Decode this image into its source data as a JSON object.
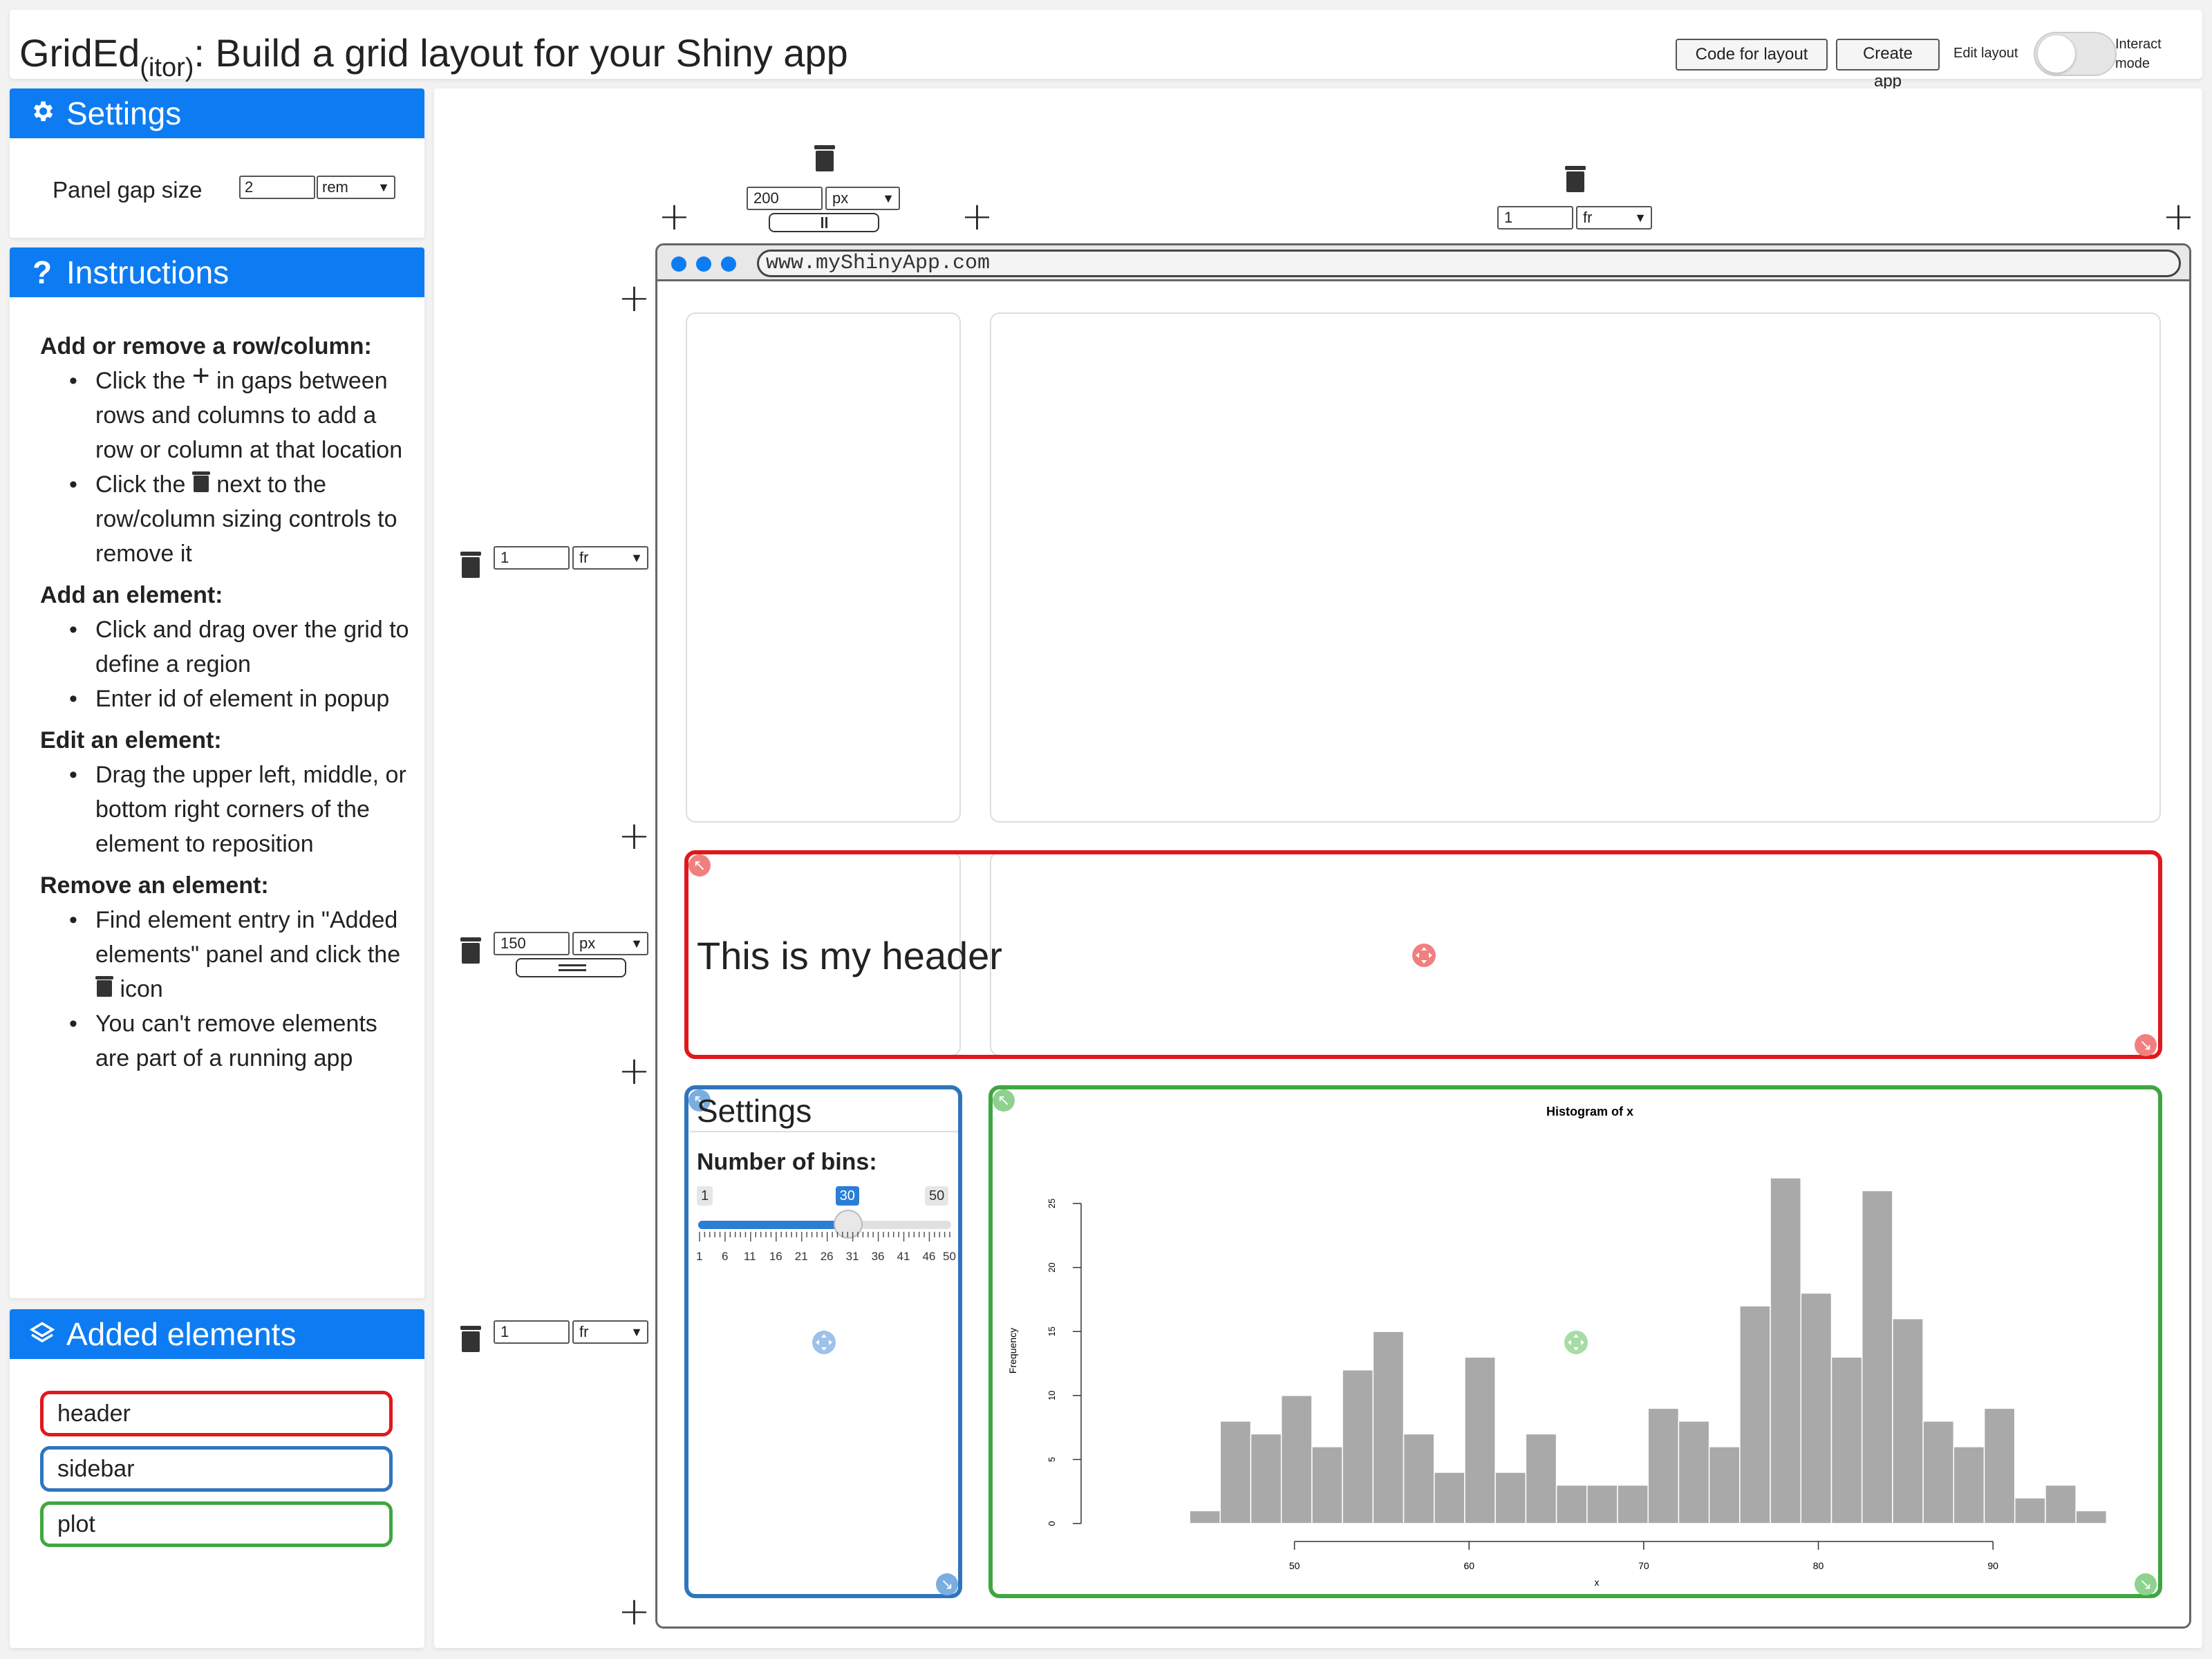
{
  "header": {
    "title_main": "GridEd",
    "title_sub": "(itor)",
    "title_rest": ": Build a grid layout for your Shiny app",
    "btn_code": "Code for layout",
    "btn_create": "Create app",
    "edit_label": "Edit layout",
    "interact_label": "Interact mode",
    "interact_on": false
  },
  "settings": {
    "title": "Settings",
    "gap_label": "Panel gap size",
    "gap_value": "2",
    "gap_unit": "rem"
  },
  "instructions": {
    "title": "Instructions",
    "s1_title": "Add or remove a row/column:",
    "s1_b1_pre": "Click the",
    "s1_b1_post": "in gaps between rows and columns to add a row or column at that location",
    "s1_b2_pre": "Click the",
    "s1_b2_post": "next to the row/column sizing controls to remove it",
    "s2_title": "Add an element:",
    "s2_b1": "Click and drag over the grid to define a region",
    "s2_b2": "Enter id of element in popup",
    "s3_title": "Edit an element:",
    "s3_b1": "Drag the upper left, middle, or bottom right corners of the element to reposition",
    "s4_title": "Remove an element:",
    "s4_b1": "Find element entry in \"Added elements\" panel",
    "s4_b1b_pre": "and click the",
    "s4_b1b_post": "icon",
    "s4_b2": "You can't remove elements are part of a running app"
  },
  "added": {
    "title": "Added elements",
    "items": [
      {
        "label": "header",
        "color": "#e0181c"
      },
      {
        "label": "sidebar",
        "color": "#2f75bd"
      },
      {
        "label": "plot",
        "color": "#3fa73f"
      }
    ]
  },
  "grid": {
    "columns": [
      {
        "value": "200",
        "unit": "px"
      },
      {
        "value": "1",
        "unit": "fr"
      }
    ],
    "rows": [
      {
        "value": "1",
        "unit": "fr"
      },
      {
        "value": "150",
        "unit": "px"
      },
      {
        "value": "1",
        "unit": "fr"
      }
    ]
  },
  "browser": {
    "url": "www.myShinyApp.com",
    "accent": "#0d7cf2"
  },
  "elements": {
    "header_text": "This is my header",
    "sidebar_title": "Settings",
    "bins_label": "Number of bins:",
    "slider": {
      "min": "1",
      "max": "50",
      "value": "30",
      "tick_labels": [
        "1",
        "6",
        "11",
        "16",
        "21",
        "26",
        "31",
        "36",
        "41",
        "46",
        "50"
      ]
    }
  },
  "chart_data": {
    "type": "bar",
    "title": "Histogram of x",
    "xlabel": "x",
    "ylabel": "Frequency",
    "x_ticks": [
      "50",
      "60",
      "70",
      "80",
      "90"
    ],
    "y_ticks": [
      "0",
      "5",
      "10",
      "15",
      "20",
      "25"
    ],
    "xlim": [
      40,
      97
    ],
    "ylim": [
      0,
      27
    ],
    "bin_width": 1.75,
    "bin_start": 44,
    "values": [
      1,
      8,
      7,
      10,
      6,
      12,
      15,
      7,
      4,
      13,
      4,
      7,
      3,
      3,
      3,
      9,
      8,
      6,
      17,
      27,
      18,
      13,
      26,
      16,
      8,
      6,
      9,
      2,
      3,
      1
    ]
  }
}
